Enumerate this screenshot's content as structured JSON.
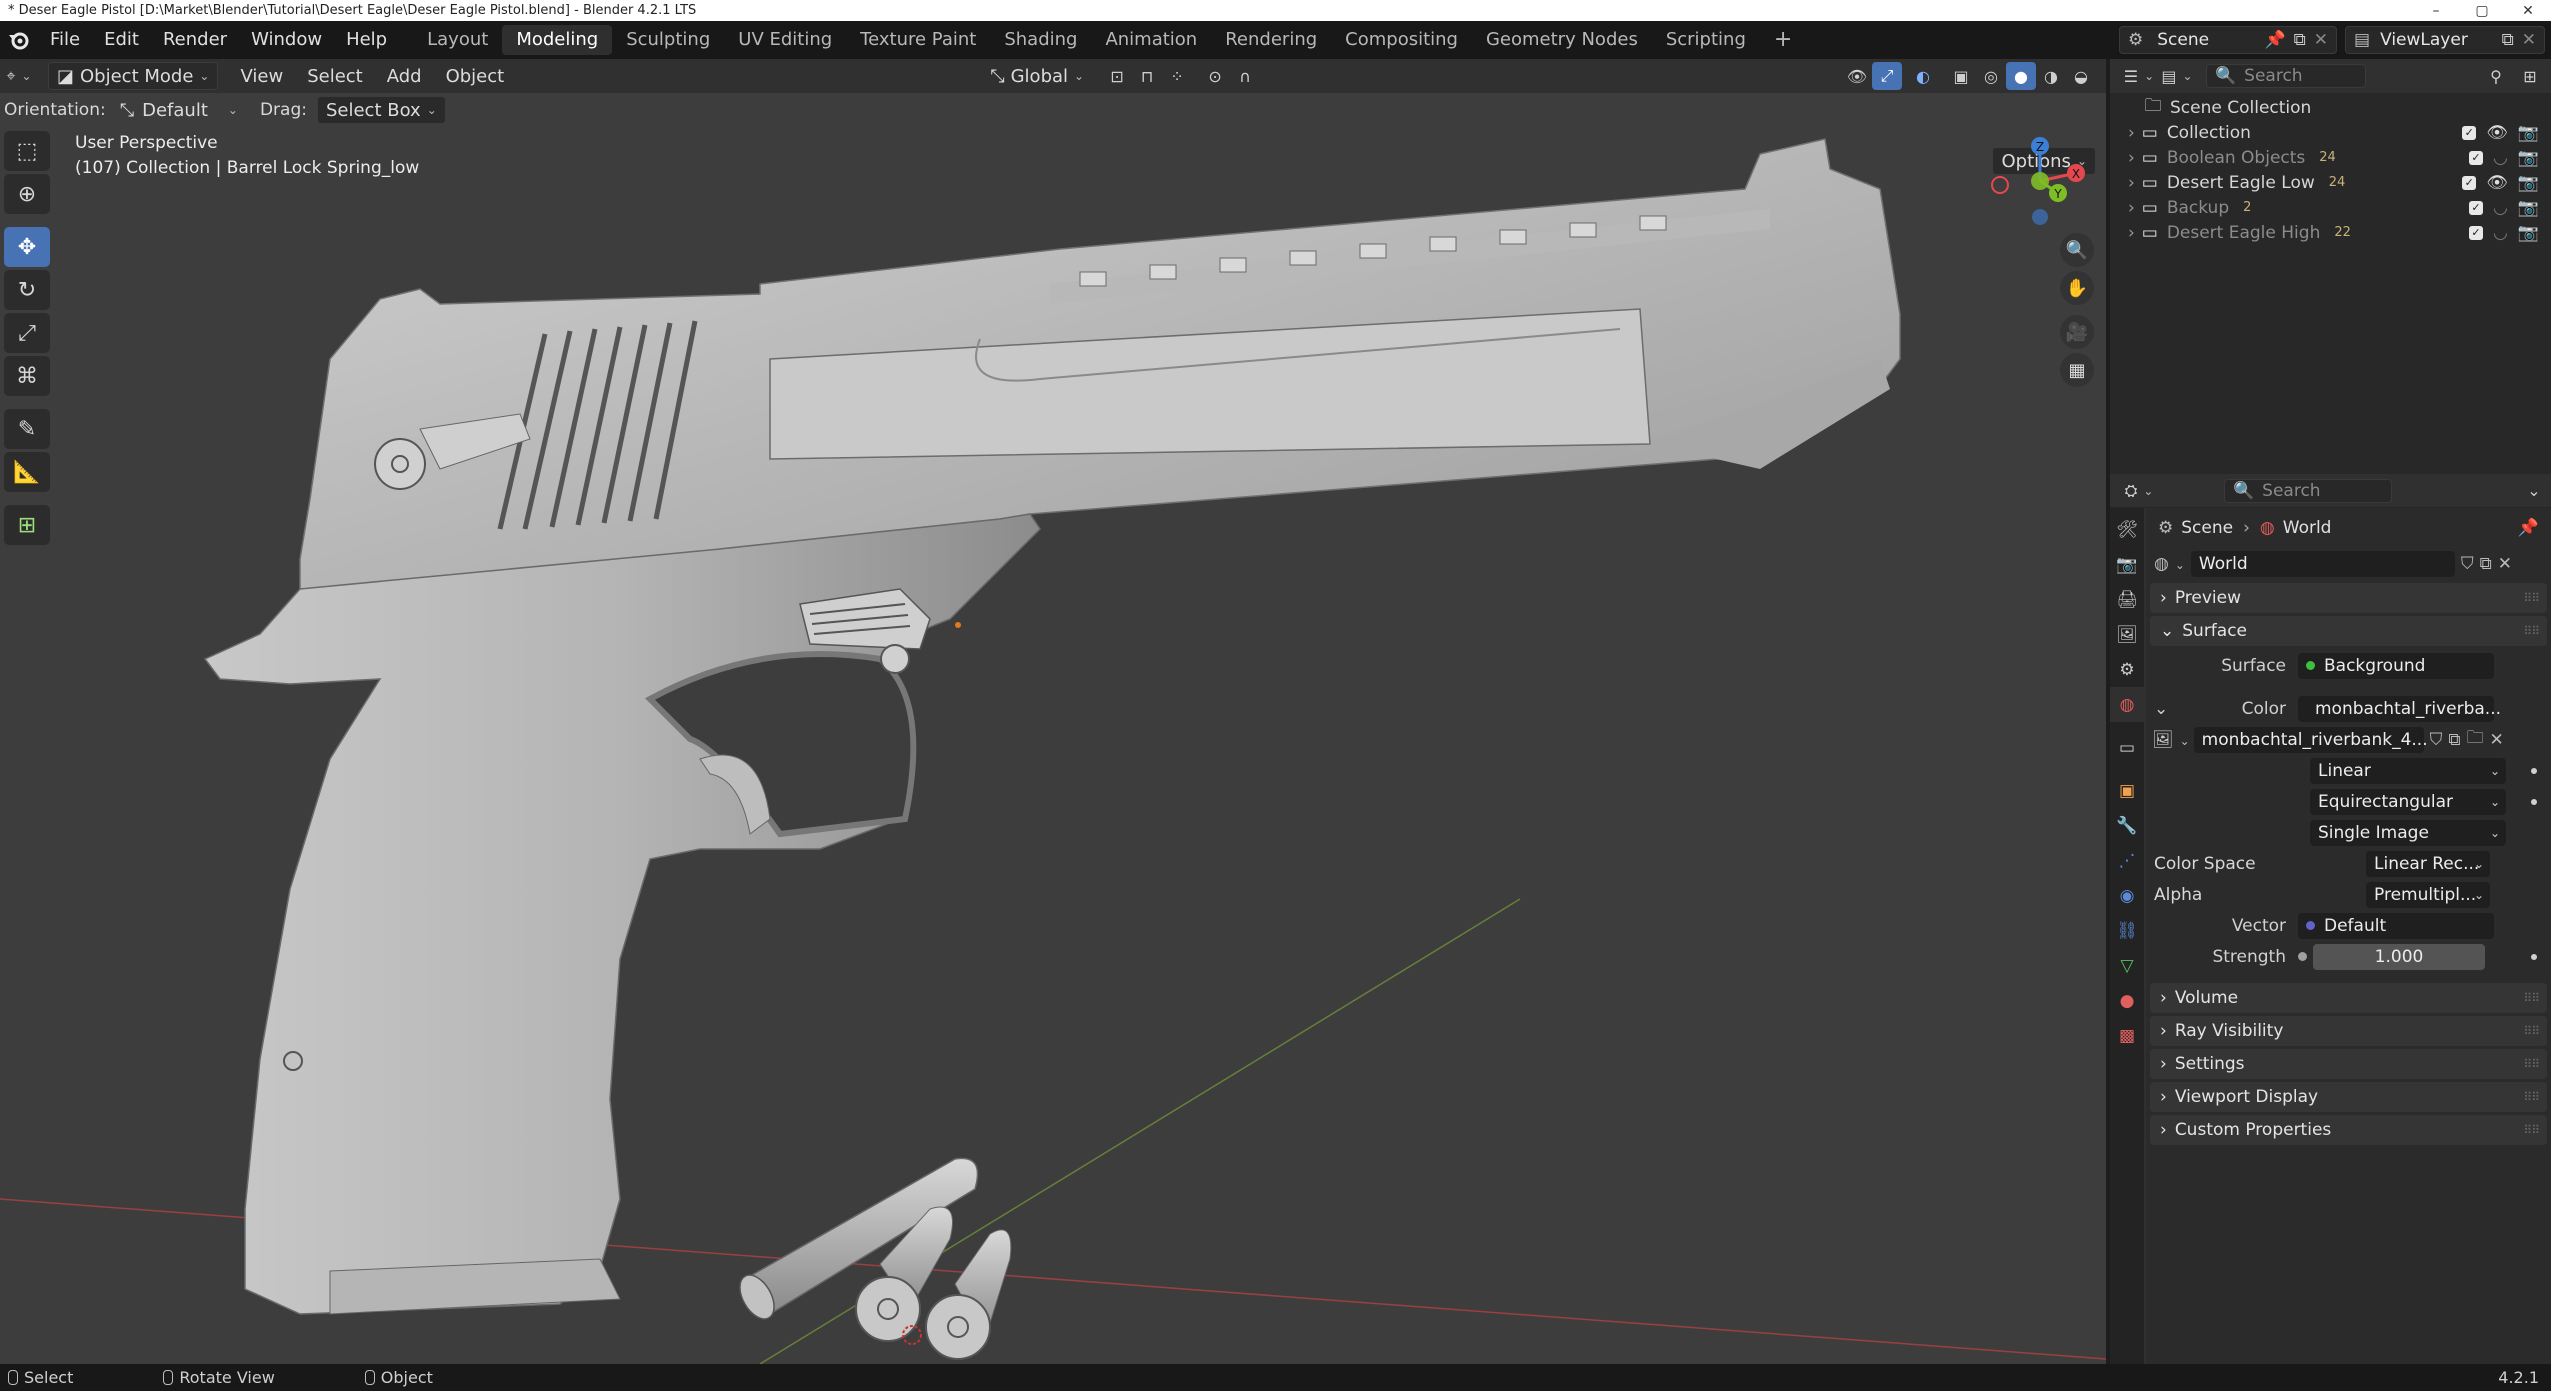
{
  "window": {
    "title": "* Deser Eagle Pistol [D:\\Market\\Blender\\Tutorial\\Desert Eagle\\Deser Eagle Pistol.blend] - Blender 4.2.1 LTS",
    "min": "–",
    "max": "▢",
    "close": "✕"
  },
  "menu": {
    "file": "File",
    "edit": "Edit",
    "render": "Render",
    "window": "Window",
    "help": "Help"
  },
  "workspaces": [
    "Layout",
    "Modeling",
    "Sculpting",
    "UV Editing",
    "Texture Paint",
    "Shading",
    "Animation",
    "Rendering",
    "Compositing",
    "Geometry Nodes",
    "Scripting"
  ],
  "active_workspace": "Modeling",
  "add_workspace": "+",
  "scene_field": "Scene",
  "view_layer_field": "ViewLayer",
  "viewport": {
    "mode": "Object Mode",
    "menus": {
      "view": "View",
      "select": "Select",
      "add": "Add",
      "object": "Object"
    },
    "transform_orientation": "Global",
    "orientation_label": "Orientation:",
    "orientation_value": "Default",
    "drag_label": "Drag:",
    "drag_value": "Select Box",
    "options": "Options",
    "info_line1": "User Perspective",
    "info_line2": "(107) Collection | Barrel Lock Spring_low",
    "gizmo": {
      "z": "Z",
      "y": "Y",
      "x": "X"
    }
  },
  "outliner": {
    "search_placeholder": "Search",
    "root": "Scene Collection",
    "items": [
      {
        "name": "Collection",
        "badge": "",
        "dim": false
      },
      {
        "name": "Boolean Objects",
        "badge": "24",
        "dim": true
      },
      {
        "name": "Desert Eagle Low",
        "badge": "24",
        "dim": false
      },
      {
        "name": "Backup",
        "badge": "2",
        "dim": true
      },
      {
        "name": "Desert Eagle High",
        "badge": "22",
        "dim": true
      }
    ]
  },
  "properties": {
    "search_placeholder": "Search",
    "breadcrumb_scene": "Scene",
    "breadcrumb_world": "World",
    "world_name": "World",
    "panels": {
      "preview": "Preview",
      "surface": "Surface",
      "volume": "Volume",
      "ray_visibility": "Ray Visibility",
      "settings": "Settings",
      "viewport_display": "Viewport Display",
      "custom_properties": "Custom Properties"
    },
    "surface_label": "Surface",
    "surface_value": "Background",
    "color_label": "Color",
    "color_value": "monbachtal_riverba...",
    "image_name": "monbachtal_riverbank_4...",
    "interpolation": "Linear",
    "projection": "Equirectangular",
    "source": "Single Image",
    "color_space_label": "Color Space",
    "color_space_value": "Linear Rec...",
    "alpha_label": "Alpha",
    "alpha_value": "Premultipl...",
    "vector_label": "Vector",
    "vector_value": "Default",
    "strength_label": "Strength",
    "strength_value": "1.000"
  },
  "status": {
    "select": "Select",
    "rotate": "Rotate View",
    "object": "Object",
    "version": "4.2.1"
  },
  "colors": {
    "accent": "#4772b3",
    "surface_dot": "#3fbf3f",
    "color_dot": "#c7c729",
    "vector_dot": "#6363c7",
    "x_axis": "#e4484e",
    "y_axis": "#7fbd27",
    "z_axis": "#3c7fd6"
  }
}
